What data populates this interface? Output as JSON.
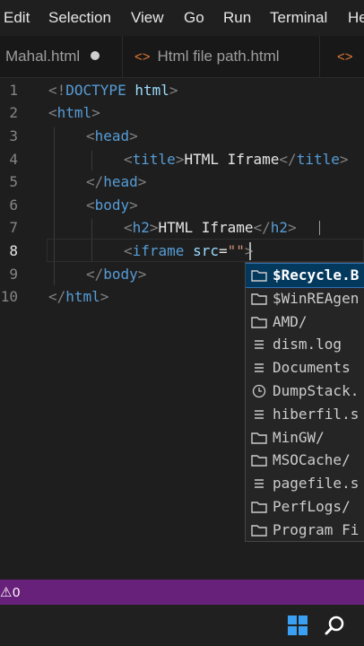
{
  "menu": {
    "items": [
      "Edit",
      "Selection",
      "View",
      "Go",
      "Run",
      "Terminal",
      "He"
    ]
  },
  "tabs": [
    {
      "label": "Mahal.html",
      "modified": true
    },
    {
      "label": "Html file path.html"
    },
    {
      "label": ""
    }
  ],
  "editor": {
    "line_numbers": [
      "1",
      "2",
      "3",
      "4",
      "5",
      "6",
      "7",
      "8",
      "9",
      "10"
    ],
    "active_line": "8",
    "lines": {
      "l1": {
        "bang": "<!",
        "doctype": "DOCTYPE",
        "html": "html",
        "close": ">"
      },
      "l2": {
        "open": "<",
        "tag": "html",
        "close": ">"
      },
      "l3": {
        "open": "<",
        "tag": "head",
        "close": ">"
      },
      "l4": {
        "open": "<",
        "tag": "title",
        "close": ">",
        "text": "HTML Iframe",
        "eopen": "</",
        "etag": "title",
        "eclose": ">"
      },
      "l5": {
        "open": "</",
        "tag": "head",
        "close": ">"
      },
      "l6": {
        "open": "<",
        "tag": "body",
        "close": ">"
      },
      "l7": {
        "open": "<",
        "tag": "h2",
        "close": ">",
        "text": "HTML Iframe",
        "eopen": "</",
        "etag": "h2",
        "eclose": ">"
      },
      "l8": {
        "open": "<",
        "tag": "iframe",
        "attr": "src",
        "eq": "=",
        "value": "\"\"",
        "close": ">"
      },
      "l9": {
        "open": "</",
        "tag": "body",
        "close": ">"
      },
      "l10": {
        "open": "</",
        "tag": "html",
        "close": ">"
      }
    }
  },
  "suggestions": [
    {
      "label": "$Recycle.B",
      "icon": "folder-icon",
      "selected": true
    },
    {
      "label": "$WinREAgen",
      "icon": "folder-icon"
    },
    {
      "label": "AMD/",
      "icon": "folder-icon"
    },
    {
      "label": "dism.log",
      "icon": "file-icon"
    },
    {
      "label": "Documents",
      "icon": "file-icon"
    },
    {
      "label": "DumpStack.",
      "icon": "clock-icon"
    },
    {
      "label": "hiberfil.s",
      "icon": "file-icon"
    },
    {
      "label": "MinGW/",
      "icon": "folder-icon"
    },
    {
      "label": "MSOCache/",
      "icon": "folder-icon"
    },
    {
      "label": "pagefile.s",
      "icon": "file-icon"
    },
    {
      "label": "PerfLogs/",
      "icon": "folder-icon"
    },
    {
      "label": "Program Fi",
      "icon": "folder-icon"
    }
  ],
  "status": {
    "problems": "0"
  },
  "colors": {
    "status_bar": "#68217a",
    "tag": "#569cd6",
    "string": "#ce9178",
    "attribute": "#9cdcfe",
    "selection": "#04395e"
  }
}
